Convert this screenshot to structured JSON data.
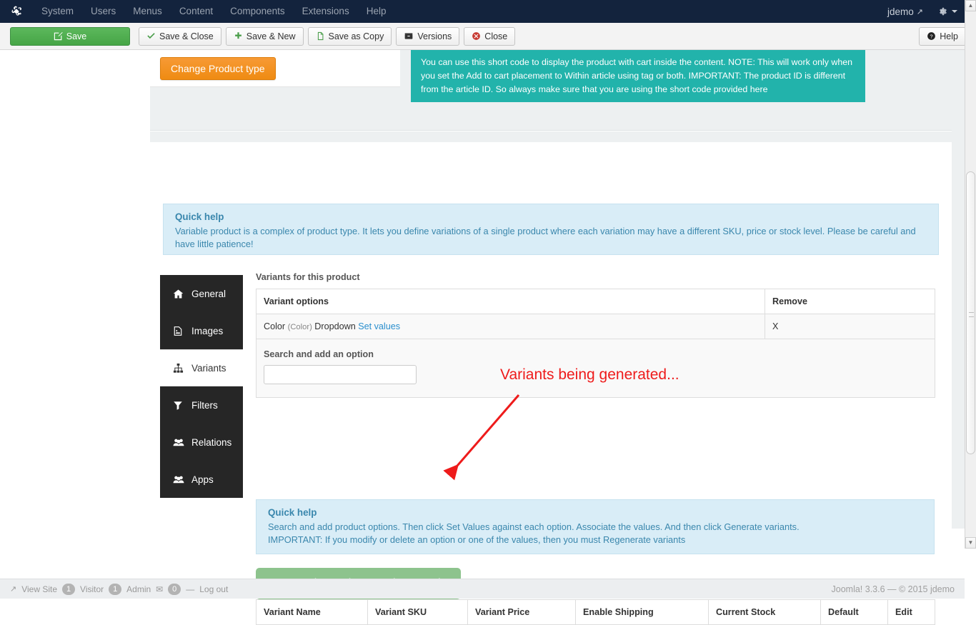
{
  "topnav": {
    "logo_icon": "joomla-logo-icon",
    "items": [
      {
        "label": "System"
      },
      {
        "label": "Users"
      },
      {
        "label": "Menus"
      },
      {
        "label": "Content"
      },
      {
        "label": "Components"
      },
      {
        "label": "Extensions"
      },
      {
        "label": "Help"
      }
    ],
    "user": "jdemo",
    "external_icon": "external-link-icon",
    "gear_icon": "gear-icon"
  },
  "toolbar": {
    "save": "Save",
    "save_close": "Save & Close",
    "save_new": "Save & New",
    "save_copy": "Save as Copy",
    "versions": "Versions",
    "close": "Close",
    "help": "Help"
  },
  "top_card": {
    "change_product_type": "Change Product type",
    "shortcode_note": "You can use this short code to display the product with cart inside the content. NOTE: This will work only when you set the Add to cart placement to Within article using tag or both. IMPORTANT: The product ID is different from the article ID. So always make sure that you are using the short code provided here"
  },
  "quick_help_1": {
    "title": "Quick help",
    "body": "Variable product is a complex of product type. It lets you define variations of a single product where each variation may have a different SKU, price or stock level. Please be careful and have little patience!"
  },
  "tabs": [
    {
      "label": "General",
      "icon": "home-icon",
      "active": false
    },
    {
      "label": "Images",
      "icon": "image-file-icon",
      "active": false
    },
    {
      "label": "Variants",
      "icon": "sitemap-icon",
      "active": true
    },
    {
      "label": "Filters",
      "icon": "funnel-icon",
      "active": false
    },
    {
      "label": "Relations",
      "icon": "users-icon",
      "active": false
    },
    {
      "label": "Apps",
      "icon": "users-icon",
      "active": false
    }
  ],
  "variants_section": {
    "heading": "Variants for this product",
    "options_table": {
      "headers": [
        "Variant options",
        "Remove"
      ],
      "rows": [
        {
          "option_name": "Color",
          "option_paren": "(Color)",
          "option_type": "Dropdown",
          "set_values_link": "Set values",
          "remove": "X"
        }
      ]
    },
    "search_label": "Search and add an option",
    "search_value": "",
    "search_placeholder": ""
  },
  "quick_help_2": {
    "title": "Quick help",
    "line1": "Search and add product options. Then click Set Values against each option. Associate the values. And then click Generate variants.",
    "line2": "IMPORTANT: If you modify or delete an option or one of the values, then you must Regenerate variants"
  },
  "generate_button": {
    "label": "Generating variants... Please wait",
    "color": "#8dc38d"
  },
  "variants_table": {
    "headers": [
      "Variant Name",
      "Variant SKU",
      "Variant Price",
      "Enable Shipping",
      "Current Stock",
      "Default",
      "Edit"
    ],
    "rows": []
  },
  "annotation": {
    "text": "Variants being generated...",
    "color": "#ee1b1b"
  },
  "footer": {
    "view_site_icon": "external-link-icon",
    "view_site": "View Site",
    "visitor_count": "1",
    "visitor_label": "Visitor",
    "admin_count": "1",
    "admin_label": "Admin",
    "mail_icon": "envelope-icon",
    "mail_count": "0",
    "logout": "Log out",
    "copyright": "Joomla! 3.3.6  —  © 2015 jdemo"
  }
}
